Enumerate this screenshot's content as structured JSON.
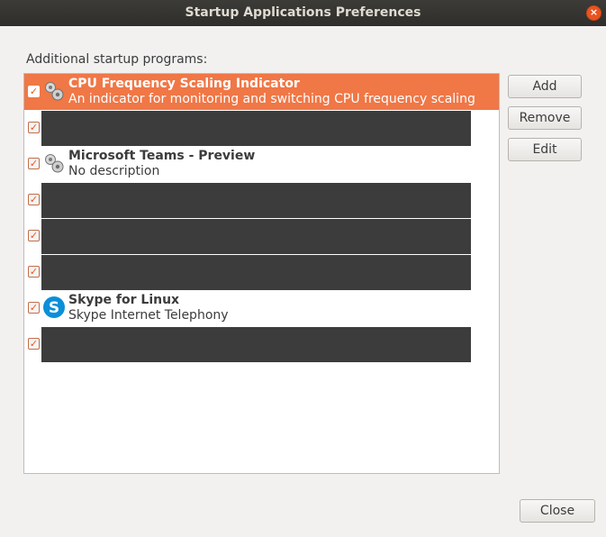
{
  "window": {
    "title": "Startup Applications Preferences",
    "close_glyph": "×"
  },
  "main": {
    "section_label": "Additional startup programs:"
  },
  "programs": [
    {
      "checked": true,
      "redacted": false,
      "selected": true,
      "icon": "gears-icon",
      "name": "CPU Frequency Scaling Indicator",
      "description": "An indicator for monitoring and switching CPU frequency scaling"
    },
    {
      "checked": true,
      "redacted": true
    },
    {
      "checked": true,
      "redacted": false,
      "selected": false,
      "icon": "gears-icon",
      "name": "Microsoft Teams - Preview",
      "description": "No description"
    },
    {
      "checked": true,
      "redacted": true
    },
    {
      "checked": true,
      "redacted": true
    },
    {
      "checked": true,
      "redacted": true
    },
    {
      "checked": true,
      "redacted": false,
      "selected": false,
      "icon": "skype-icon",
      "name": "Skype for Linux",
      "description": "Skype Internet Telephony"
    },
    {
      "checked": true,
      "redacted": true
    }
  ],
  "buttons": {
    "add": "Add",
    "remove": "Remove",
    "edit": "Edit",
    "close": "Close"
  },
  "checkbox_glyph": "✓",
  "colors": {
    "selection": "#f07746",
    "titlebar": "#3c3b37",
    "redaction": "#3c3c3c",
    "accent": "#e95420"
  }
}
